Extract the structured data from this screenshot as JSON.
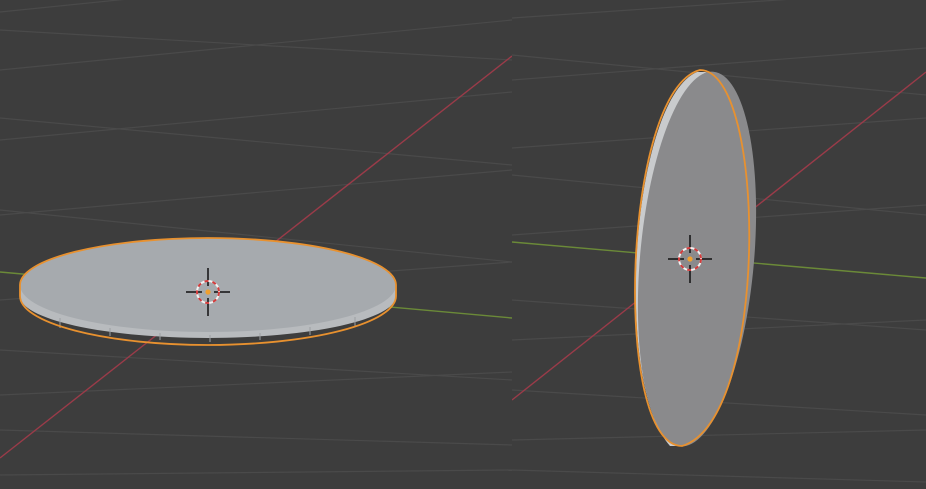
{
  "app": {
    "type": "3d-viewport-comparison"
  },
  "viewports": [
    {
      "id": "left",
      "object": "disc-mesh",
      "orientation": "horizontal",
      "selected": true
    },
    {
      "id": "right",
      "object": "disc-mesh",
      "orientation": "vertical",
      "selected": true
    }
  ],
  "colors": {
    "background": "#3d3d3d",
    "grid_line": "#4a4a4a",
    "x_axis": "#9a3b49",
    "y_axis": "#6b8a38",
    "selection_outline": "#e8912f",
    "disc_face_left": "#a4a8ac",
    "disc_face_right": "#8a8a8c",
    "disc_rim_light": "#c9cbcd",
    "disc_rim_dark": "#9c9fa2",
    "cursor_ring_red": "#d33c3c",
    "cursor_ring_white": "#f2f2f2",
    "cursor_cross": "#101010",
    "origin_dot": "#f0a030"
  },
  "icons": {
    "cursor": "3d-cursor-icon",
    "origin": "object-origin-icon"
  }
}
